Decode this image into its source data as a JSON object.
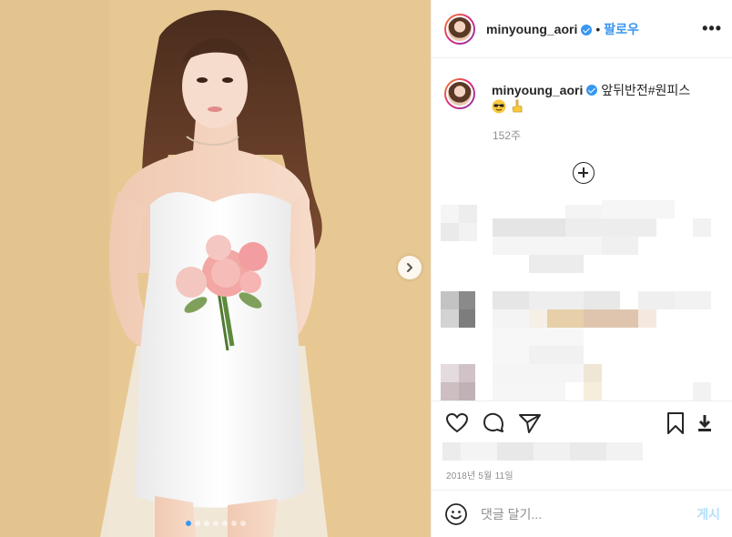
{
  "post": {
    "username": "minyoung_aori",
    "follow_separator": "•",
    "follow_label": "팔로우",
    "more_label": "•••"
  },
  "caption": {
    "username": "minyoung_aori",
    "text": "앞뒤반전#원피스",
    "meta": "152주"
  },
  "timestamp": "2018년 5월 11일",
  "comment": {
    "placeholder": "댓글 달기...",
    "post_label": "게시"
  },
  "carousel": {
    "slide_count": 7,
    "active_index": 0
  },
  "colors": {
    "accent": "#3897f0",
    "post_button_disabled": "#b2dffc",
    "background_photo": "#e6c690",
    "muted_text": "#8e8e8e"
  },
  "icons": {
    "like": "heart-icon",
    "comment": "comment-icon",
    "share": "paper-plane-icon",
    "save": "bookmark-icon",
    "download": "download-icon",
    "emoji": "smile-icon",
    "next": "chevron-right-icon",
    "load_more": "plus-circle-icon"
  }
}
